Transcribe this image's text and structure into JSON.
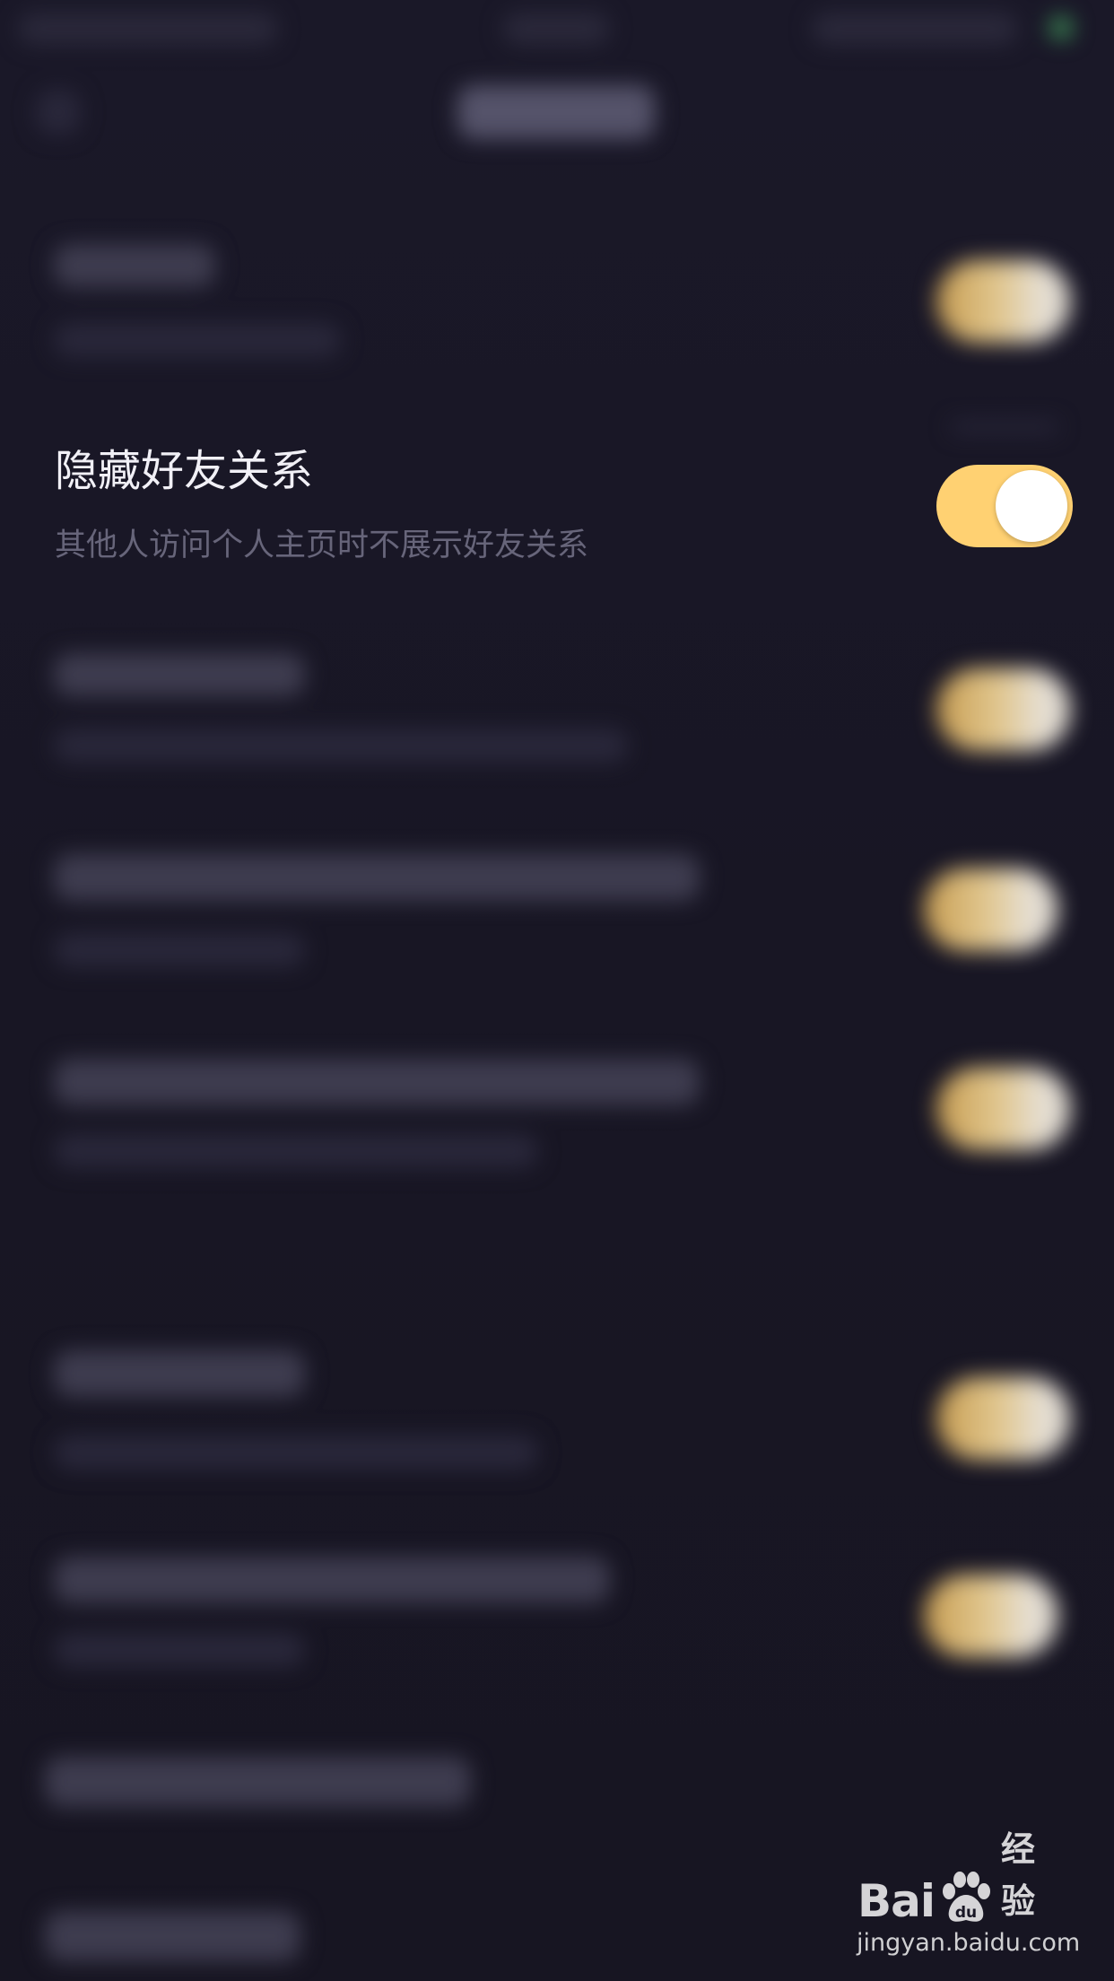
{
  "app": {
    "theme_colors": {
      "background": "#181625",
      "toggle_on": "#ffd172",
      "title_text": "#f1f0f6",
      "description_text": "#67657a"
    }
  },
  "privacy_setting": {
    "title": "隐藏好友关系",
    "description": "其他人访问个人主页时不展示好友关系",
    "toggle_state": "on"
  },
  "watermark": {
    "brand_prefix": "Bai",
    "brand_suffix": "经验",
    "url": "jingyan.baidu.com",
    "icon": "paw-icon"
  }
}
